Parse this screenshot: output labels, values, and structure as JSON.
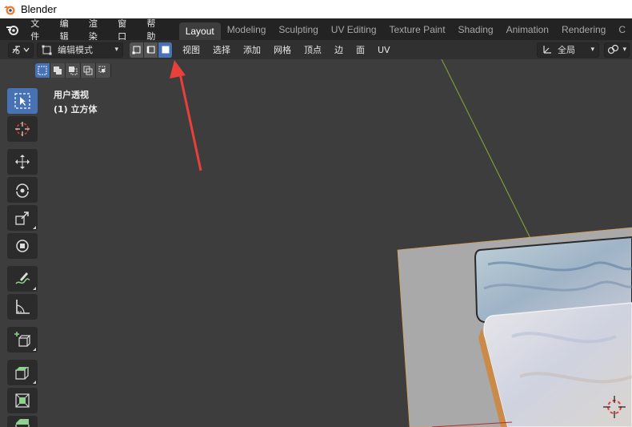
{
  "window": {
    "title": "Blender"
  },
  "menu": {
    "items": [
      "文件",
      "编辑",
      "渲染",
      "窗口",
      "帮助"
    ]
  },
  "workspaces": {
    "tabs": [
      "Layout",
      "Modeling",
      "Sculpting",
      "UV Editing",
      "Texture Paint",
      "Shading",
      "Animation",
      "Rendering",
      "C"
    ],
    "active": "Layout"
  },
  "header": {
    "mode": "编辑模式",
    "menus": [
      "视图",
      "选择",
      "添加",
      "网格",
      "顶点",
      "边",
      "面",
      "UV"
    ],
    "transform_orientation": "全局"
  },
  "viewport": {
    "view_name": "用户透视",
    "object_name": "(1) 立方体"
  },
  "toolbar": {
    "tools": [
      "select-box",
      "cursor",
      "move",
      "rotate",
      "scale",
      "transform",
      "annotate",
      "measure",
      "add-cube",
      "extrude",
      "inset",
      "bevel"
    ],
    "active": "select-box"
  },
  "colors": {
    "accent": "#4772b3",
    "annotation_arrow": "#e8403a",
    "axis_y": "#7a9a3a",
    "axis_x": "#a83232",
    "viewport_bg": "#3d3d3d"
  }
}
